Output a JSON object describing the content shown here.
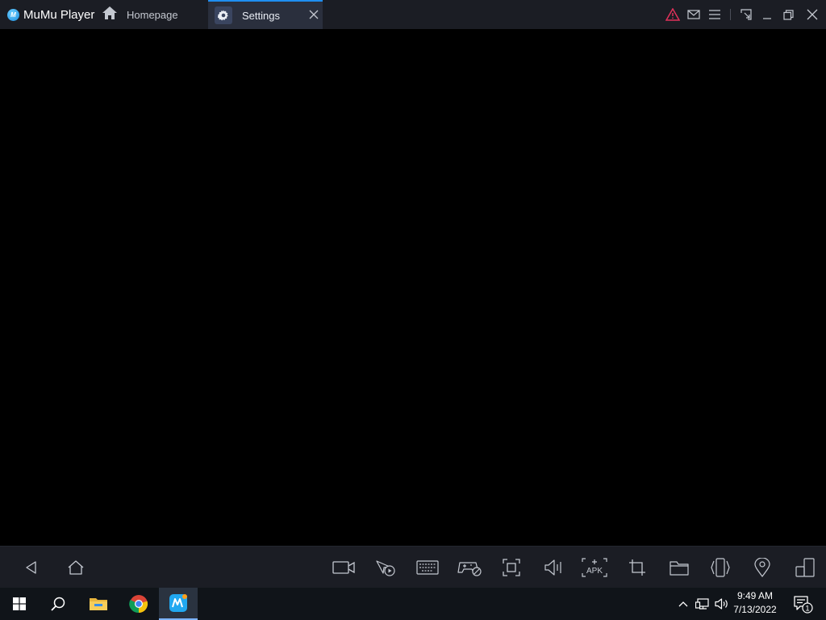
{
  "app": {
    "name": "MuMu Player",
    "logo_text": "M"
  },
  "tabs": [
    {
      "label": "Homepage",
      "icon": "home-icon",
      "active": false
    },
    {
      "label": "Settings",
      "icon": "gear-icon",
      "active": true
    }
  ],
  "title_buttons": [
    "warning-icon",
    "mail-icon",
    "menu-icon",
    "keymap-icon",
    "minimize-icon",
    "restore-icon",
    "close-icon"
  ],
  "toolbar": {
    "left": [
      "back-icon",
      "home-icon"
    ],
    "right": [
      "record-video-icon",
      "operation-record-icon",
      "keyboard-icon",
      "gamepad-icon",
      "fullscreen-icon",
      "volume-icon",
      "install-apk-icon",
      "screenshot-crop-icon",
      "shared-folder-icon",
      "shake-icon",
      "location-icon",
      "multi-instance-icon"
    ],
    "apk_label": "APK"
  },
  "taskbar": {
    "pinned": [
      "windows-start-icon",
      "search-icon",
      "file-explorer-icon",
      "chrome-icon",
      "mumu-player-icon"
    ],
    "tray": [
      "chevron-up-icon",
      "network-icon",
      "speaker-icon"
    ],
    "time": "9:49 AM",
    "date": "7/13/2022",
    "notification_count": "1"
  },
  "colors": {
    "titlebar_bg": "#1b1d24",
    "active_tab_bg": "#2a2f3d",
    "accent": "#1f8ef1",
    "warning": "#e0315a",
    "screen_bg": "#000000",
    "taskbar_bg": "#101419"
  }
}
